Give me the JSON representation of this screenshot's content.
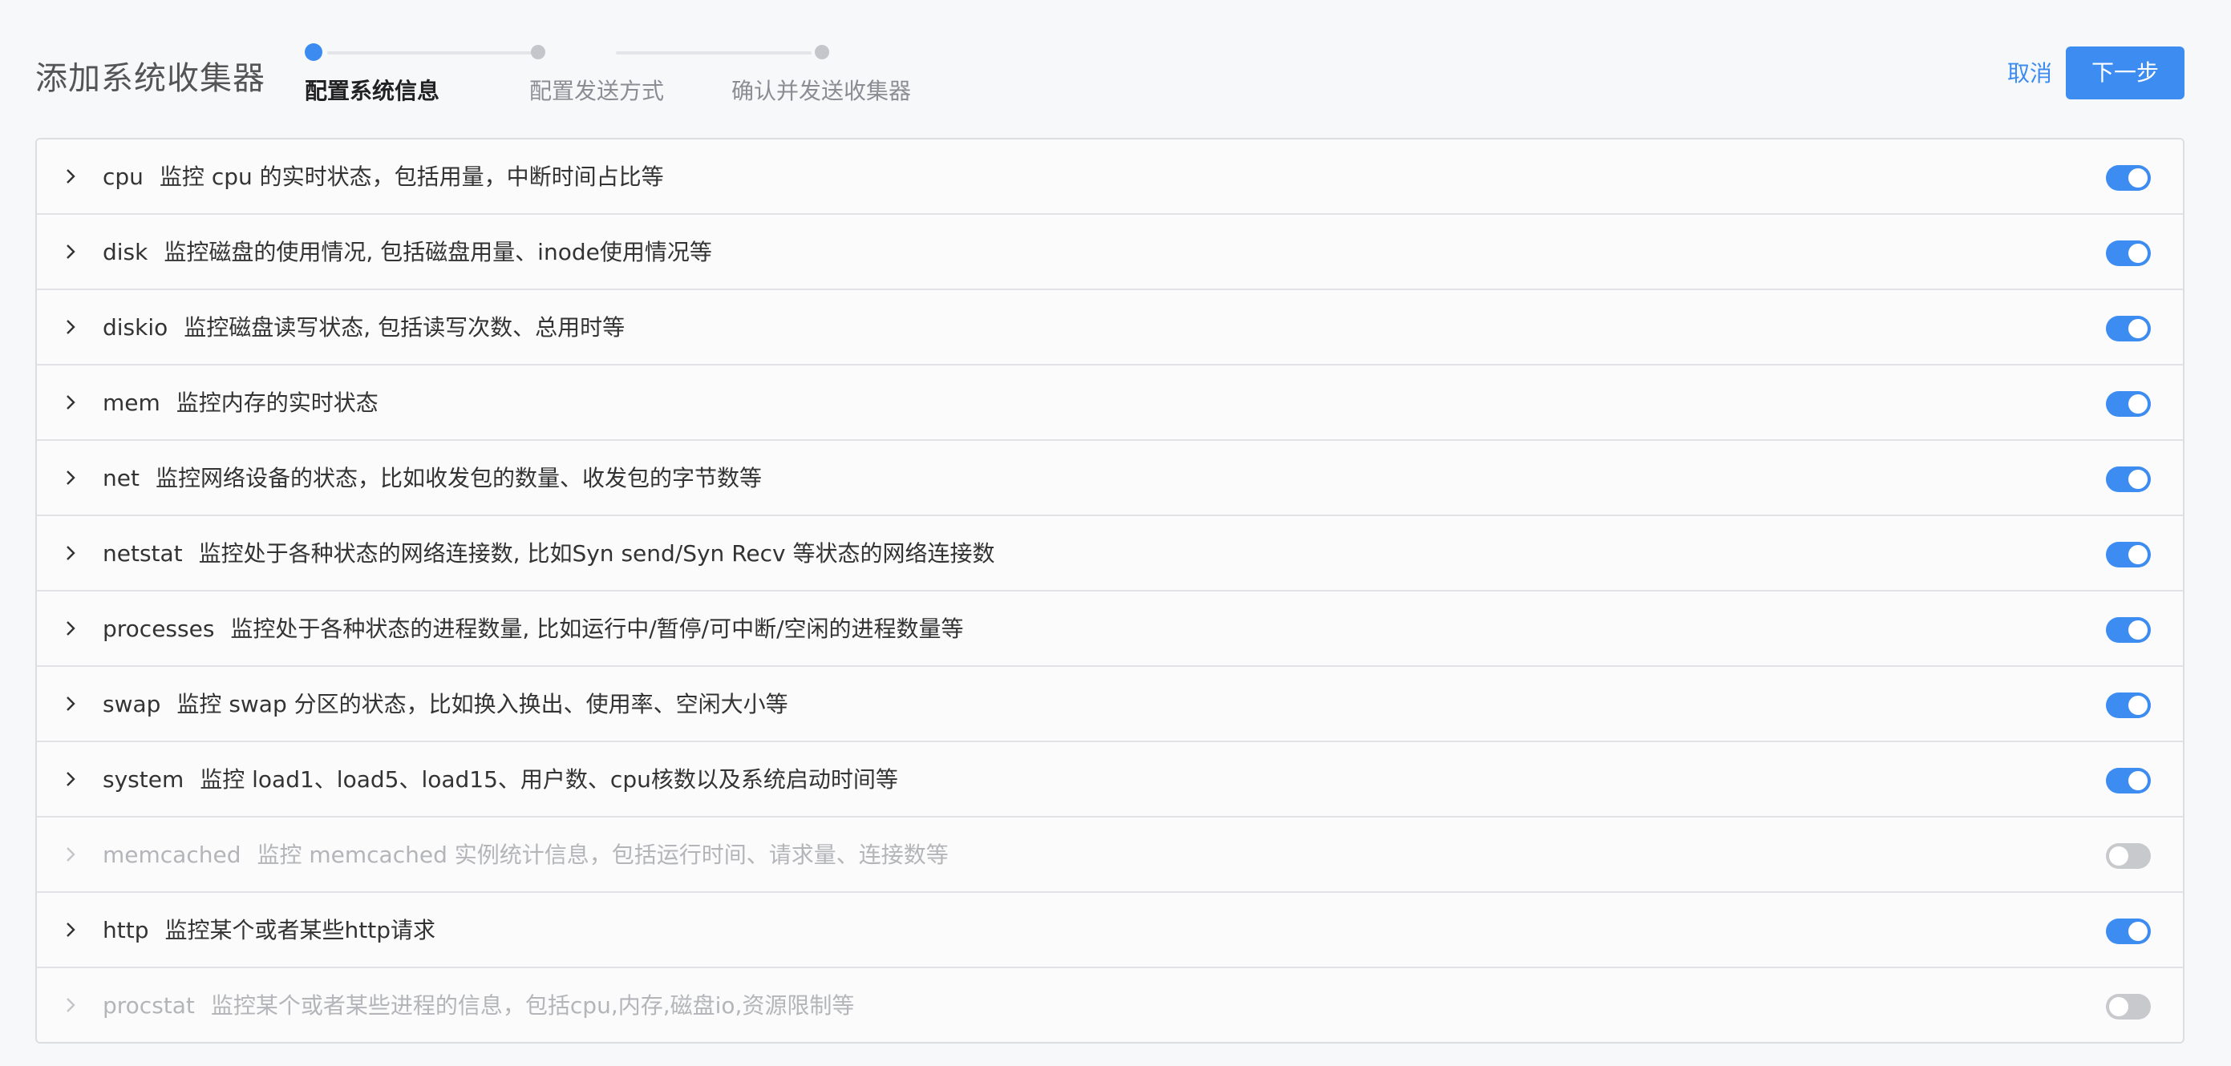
{
  "header": {
    "title": "添加系统收集器",
    "cancel_label": "取消",
    "next_label": "下一步"
  },
  "steps": [
    {
      "label": "配置系统信息",
      "active": true
    },
    {
      "label": "配置发送方式",
      "active": false
    },
    {
      "label": "确认并发送收集器",
      "active": false
    }
  ],
  "collectors": [
    {
      "name": "cpu",
      "desc": "监控 cpu 的实时状态，包括用量，中断时间占比等",
      "enabled": true
    },
    {
      "name": "disk",
      "desc": "监控磁盘的使用情况, 包括磁盘用量、inode使用情况等",
      "enabled": true
    },
    {
      "name": "diskio",
      "desc": "监控磁盘读写状态, 包括读写次数、总用时等",
      "enabled": true
    },
    {
      "name": "mem",
      "desc": "监控内存的实时状态",
      "enabled": true
    },
    {
      "name": "net",
      "desc": "监控网络设备的状态，比如收发包的数量、收发包的字节数等",
      "enabled": true
    },
    {
      "name": "netstat",
      "desc": "监控处于各种状态的网络连接数, 比如Syn send/Syn Recv 等状态的网络连接数",
      "enabled": true
    },
    {
      "name": "processes",
      "desc": "监控处于各种状态的进程数量, 比如运行中/暂停/可中断/空闲的进程数量等",
      "enabled": true
    },
    {
      "name": "swap",
      "desc": "监控 swap 分区的状态，比如换入换出、使用率、空闲大小等",
      "enabled": true
    },
    {
      "name": "system",
      "desc": "监控 load1、load5、load15、用户数、cpu核数以及系统启动时间等",
      "enabled": true
    },
    {
      "name": "memcached",
      "desc": "监控 memcached 实例统计信息，包括运行时间、请求量、连接数等",
      "enabled": false
    },
    {
      "name": "http",
      "desc": "监控某个或者某些http请求",
      "enabled": true
    },
    {
      "name": "procstat",
      "desc": "监控某个或者某些进程的信息，包括cpu,内存,磁盘io,资源限制等",
      "enabled": false
    }
  ],
  "colors": {
    "accent": "#3d8cf2",
    "toggle_off": "#c8c9cc",
    "disabled_text": "#b3b5b9"
  },
  "icons": {
    "row_expand": "chevron-right-icon"
  }
}
